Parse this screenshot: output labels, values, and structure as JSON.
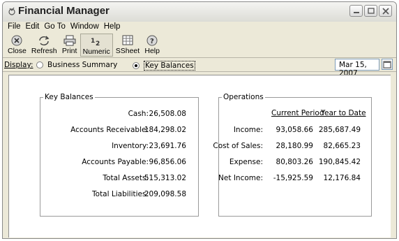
{
  "window": {
    "title": "Financial Manager"
  },
  "menu": [
    "File",
    "Edit",
    "Go To",
    "Window",
    "Help"
  ],
  "toolbar": {
    "close": "Close",
    "refresh": "Refresh",
    "print": "Print",
    "numeric": "Numeric",
    "ssheet": "SSheet",
    "help": "Help"
  },
  "display": {
    "label": "Display:",
    "option_business": "Business Summary",
    "option_key_balances": "Key Balances",
    "selected": "Key Balances",
    "date": "Mar 15, 2007"
  },
  "key_balances": {
    "title": "Key Balances",
    "rows": [
      {
        "label": "Cash:",
        "value": "26,508.08"
      },
      {
        "label": "Accounts Receivable:",
        "value": "184,298.02"
      },
      {
        "label": "Inventory:",
        "value": "23,691.76"
      },
      {
        "label": "Accounts Payable:",
        "value": "96,856.06"
      },
      {
        "label": "Total Assets:",
        "value": "515,313.02"
      },
      {
        "label": "Total Liabilities:",
        "value": "209,098.58"
      }
    ]
  },
  "operations": {
    "title": "Operations",
    "col_current": "Current Period",
    "col_ytd": "Year to Date",
    "rows": [
      {
        "label": "Income:",
        "current": "93,058.66",
        "ytd": "285,687.49"
      },
      {
        "label": "Cost of Sales:",
        "current": "28,180.99",
        "ytd": "82,665.23"
      },
      {
        "label": "Expense:",
        "current": "80,803.26",
        "ytd": "190,845.42"
      },
      {
        "label": "Net Income:",
        "current": "-15,925.59",
        "ytd": "12,176.84"
      }
    ]
  }
}
